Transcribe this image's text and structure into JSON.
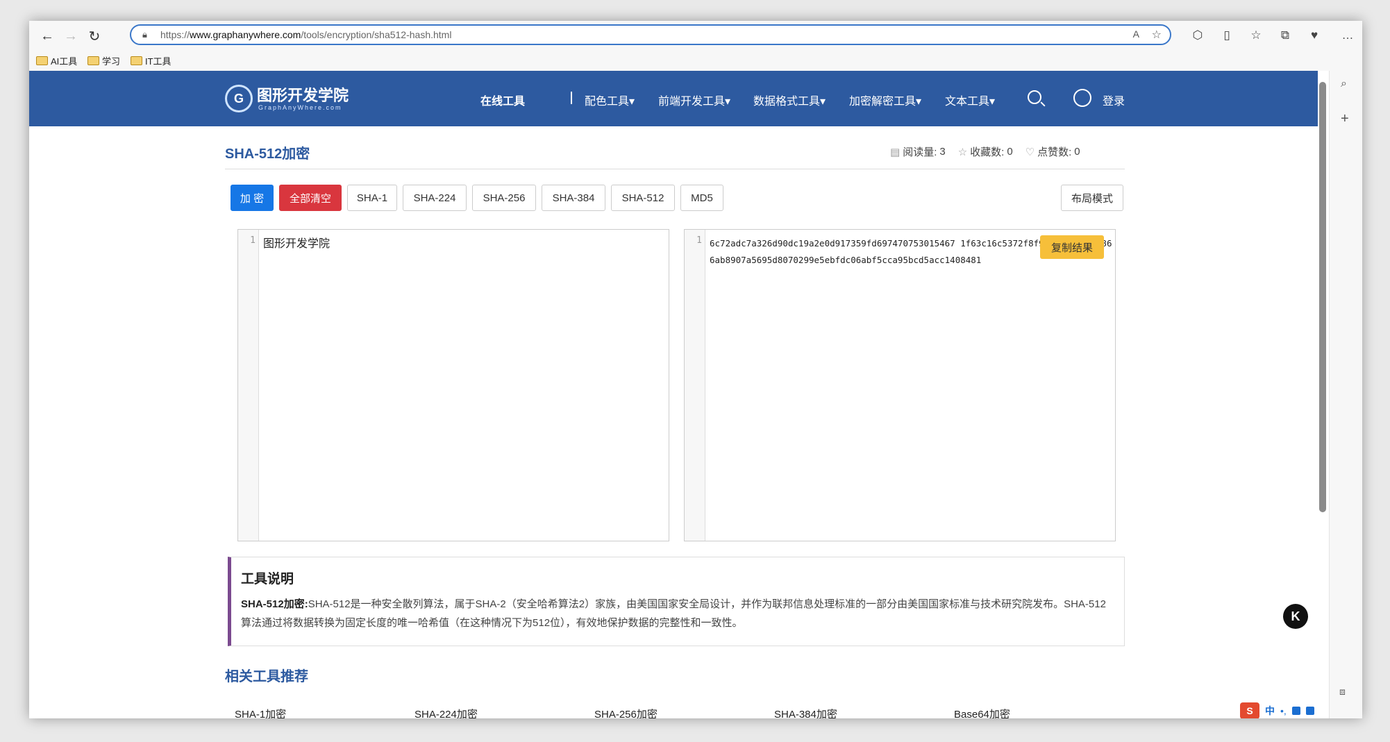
{
  "browser": {
    "url_prefix": "https://",
    "url_host": "www.graphanywhere.com",
    "url_path": "/tools/encryption/sha512-hash.html",
    "bookmarks": [
      "AI工具",
      "学习",
      "IT工具"
    ]
  },
  "site": {
    "logo_text": "图形开发学院",
    "logo_sub": "GraphAnyWhere.com",
    "nav": [
      "在线工具",
      "配色工具▾",
      "前端开发工具▾",
      "数据格式工具▾",
      "加密解密工具▾",
      "文本工具▾"
    ],
    "login": "登录"
  },
  "page": {
    "title": "SHA-512加密",
    "stats": {
      "reads_label": "阅读量:",
      "reads": "3",
      "fav_label": "收藏数:",
      "fav": "0",
      "likes_label": "点赞数:",
      "likes": "0"
    },
    "buttons": {
      "encrypt": "加 密",
      "clear": "全部清空",
      "sha1": "SHA-1",
      "sha224": "SHA-224",
      "sha256": "SHA-256",
      "sha384": "SHA-384",
      "sha512": "SHA-512",
      "md5": "MD5",
      "layout": "布局模式"
    },
    "input_editor": {
      "line": "1",
      "text": "图形开发学院"
    },
    "output_editor": {
      "line": "1",
      "text": "6c72adc7a326d90dc19a2e0d917359fd697470753015467 1f63c16c5372f8f93f6b5b26c32866ab8907a5695d8070299e5ebfdc06abf5cca95bcd5acc1408481"
    },
    "copy_button": "复制结果",
    "description": {
      "title": "工具说明",
      "lead": "SHA-512加密:",
      "body": "SHA-512是一种安全散列算法，属于SHA-2（安全哈希算法2）家族，由美国国家安全局设计，并作为联邦信息处理标准的一部分由美国国家标准与技术研究院发布。SHA-512算法通过将数据转换为固定长度的唯一哈希值（在这种情况下为512位），有效地保护数据的完整性和一致性。"
    },
    "related": {
      "title": "相关工具推荐",
      "items": [
        "SHA-1加密",
        "SHA-224加密",
        "SHA-256加密",
        "SHA-384加密",
        "Base64加密"
      ]
    }
  },
  "colors": {
    "header_bg": "#2d5aa0",
    "primary_btn": "#1677e6",
    "danger_btn": "#d9363e",
    "copy_btn": "#f6bf3a"
  }
}
